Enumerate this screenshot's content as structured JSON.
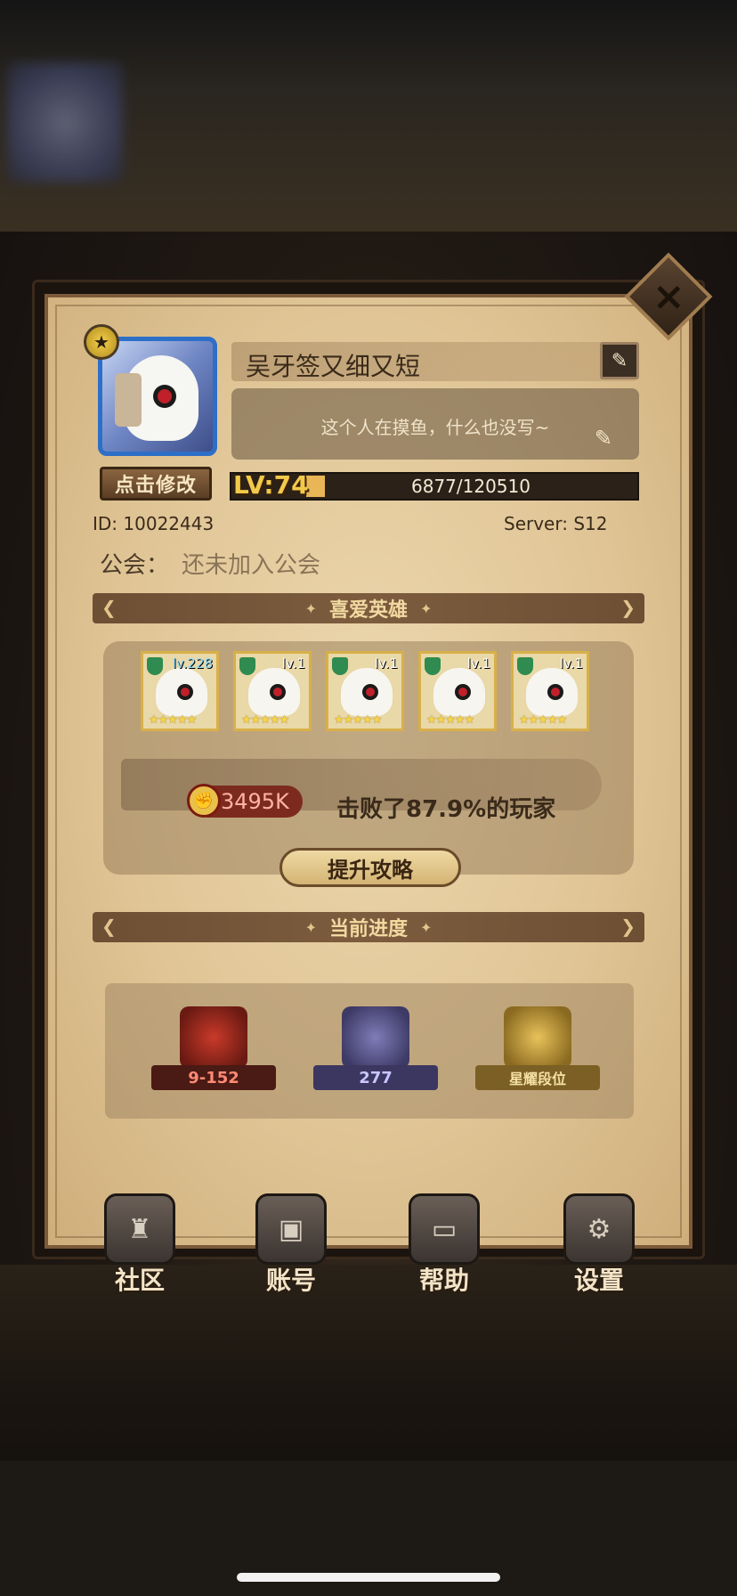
{
  "profile": {
    "modify_label": "点击修改",
    "name": "吴牙签又细又短",
    "signature": "这个人在摸鱼，什么也没写~",
    "level_label": "LV:74",
    "exp_text": "6877/120510",
    "exp_fraction": 0.057,
    "id_label": "ID:",
    "id_value": "10022443",
    "server_label": "Server:",
    "server_value": "S12",
    "guild_label": "公会：",
    "guild_value": "还未加入公会"
  },
  "favorite_heroes": {
    "title": "喜爱英雄",
    "heroes": [
      {
        "level": "lv.228",
        "stars": "★★★★★"
      },
      {
        "level": "lv.1",
        "stars": "★★★★★"
      },
      {
        "level": "lv.1",
        "stars": "★★★★★"
      },
      {
        "level": "lv.1",
        "stars": "★★★★★"
      },
      {
        "level": "lv.1",
        "stars": "★★★★★"
      }
    ],
    "power_value": "3495K",
    "defeat_text": "击败了87.9%的玩家",
    "strategy_button": "提升攻略"
  },
  "progress": {
    "title": "当前进度",
    "badges": [
      "9-152",
      "277",
      "星耀段位"
    ]
  },
  "nav": {
    "items": [
      {
        "label": "社区",
        "icon": "castle-icon"
      },
      {
        "label": "账号",
        "icon": "account-card-icon"
      },
      {
        "label": "帮助",
        "icon": "chat-bubble-icon"
      },
      {
        "label": "设置",
        "icon": "gear-icon"
      }
    ]
  },
  "colors": {
    "parchment": "#e0c596",
    "header_brown": "#7d5c3e",
    "level_gold": "#f2c94a",
    "power_red": "#7d2a1e"
  }
}
